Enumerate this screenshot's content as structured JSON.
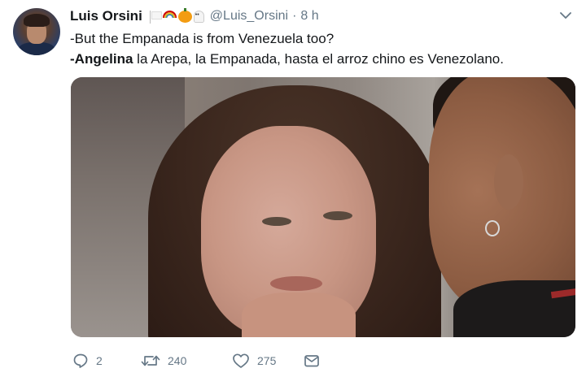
{
  "tweet": {
    "display_name": "Luis Orsini",
    "emojis": [
      "white-flag-icon",
      "rainbow-icon",
      "pumpkin-icon",
      "ghost-icon"
    ],
    "handle": "@Luis_Orsini",
    "separator": "·",
    "time": "8 h",
    "lines": [
      {
        "bold": "",
        "text": "-But the Empanada is from Venezuela too?"
      },
      {
        "bold": "-Angelina",
        "text": " la Arepa, la Empanada, hasta el arroz chino es Venezolano."
      }
    ],
    "media": {
      "kind": "photo"
    },
    "actions": {
      "reply_count": "2",
      "retweet_count": "240",
      "like_count": "275"
    }
  },
  "colors": {
    "text_primary": "#14171a",
    "text_secondary": "#657786",
    "icon": "#657786"
  }
}
